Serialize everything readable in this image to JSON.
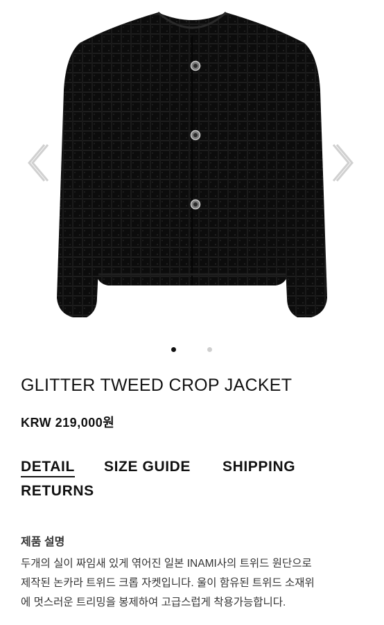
{
  "product": {
    "title": "GLITTER TWEED CROP JACKET",
    "price": "KRW 219,000원"
  },
  "gallery": {
    "total_slides": 2,
    "active_slide": 1,
    "prev_icon": "chevron-left-icon",
    "next_icon": "chevron-right-icon"
  },
  "tabs": [
    {
      "label": "DETAIL",
      "active": true
    },
    {
      "label": "SIZE GUIDE",
      "active": false
    },
    {
      "label": "SHIPPING",
      "active": false
    },
    {
      "label": "RETURNS",
      "active": false
    }
  ],
  "description": {
    "heading": "제품 설명",
    "lines": [
      "두개의 실이 짜임새 있게 엮어진 일본 INAMI사의 트위드 원단으로",
      "제작된 논카라 트위드 크롭 자켓입니다. 울이 함유된 트위드 소재위",
      "에 멋스러운 트리밍을 봉제하여 고급스럽게 착용가능합니다."
    ]
  },
  "colors": {
    "jacket": "#0d0d0d",
    "button": "#8a8a8a",
    "dot_active": "#111111",
    "dot_inactive": "#cfcfcf",
    "text": "#111111"
  }
}
